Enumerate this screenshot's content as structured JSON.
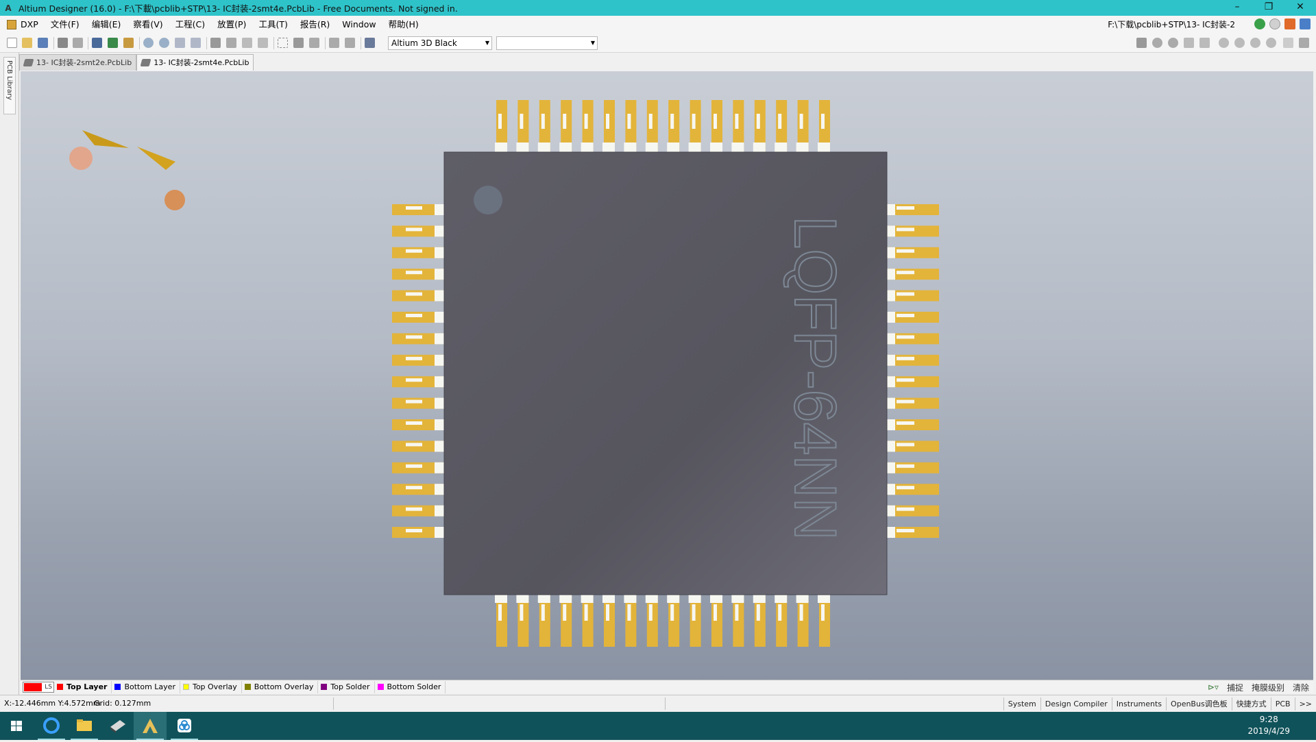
{
  "window": {
    "title": "Altium Designer (16.0) - F:\\下載\\pcblib+STP\\13- IC封装-2smt4e.PcbLib - Free Documents. Not signed in.",
    "app_icon_letter": "A",
    "minimize": "–",
    "restore": "❐",
    "close": "✕"
  },
  "menu": {
    "items": [
      "DXP",
      "文件(F)",
      "编辑(E)",
      "察看(V)",
      "工程(C)",
      "放置(P)",
      "工具(T)",
      "报告(R)",
      "Window",
      "帮助(H)"
    ],
    "path": "F:\\下载\\pcblib+STP\\13- IC封装-2"
  },
  "toolbar": {
    "view_config": "Altium 3D Black",
    "second_combo": ""
  },
  "doc_tabs": [
    {
      "label": "13- IC封装-2smt2e.PcbLib",
      "active": false
    },
    {
      "label": "13- IC封装-2smt4e.PcbLib",
      "active": true
    }
  ],
  "left_panel": {
    "tab_label": "PCB Library"
  },
  "canvas": {
    "chip_marking": "LQFP-64NN",
    "pins_per_side": 16,
    "colors": {
      "pin": "#e3b43a",
      "pin_tip": "#f7f7f2",
      "body": "#5b5a63",
      "pin1_dot": "#6a7280"
    }
  },
  "layers": {
    "current_indicator": "LS",
    "tabs": [
      {
        "label": "Top Layer",
        "color": "#ff0000",
        "active": true
      },
      {
        "label": "Bottom Layer",
        "color": "#0000ff",
        "active": false
      },
      {
        "label": "Top Overlay",
        "color": "#ffff00",
        "active": false
      },
      {
        "label": "Bottom Overlay",
        "color": "#808000",
        "active": false
      },
      {
        "label": "Top Solder",
        "color": "#800080",
        "active": false
      },
      {
        "label": "Bottom Solder",
        "color": "#ff00ff",
        "active": false
      }
    ],
    "right_controls": [
      "捕捉",
      "掩膜级别",
      "清除"
    ]
  },
  "status": {
    "coords": "X:-12.446mm Y:4.572mm",
    "grid": "Grid: 0.127mm",
    "panels": [
      "System",
      "Design Compiler",
      "Instruments",
      "OpenBus调色板",
      "快捷方式",
      "PCB",
      ">>"
    ]
  },
  "taskbar": {
    "time": "9:28",
    "date": "2019/4/29"
  }
}
